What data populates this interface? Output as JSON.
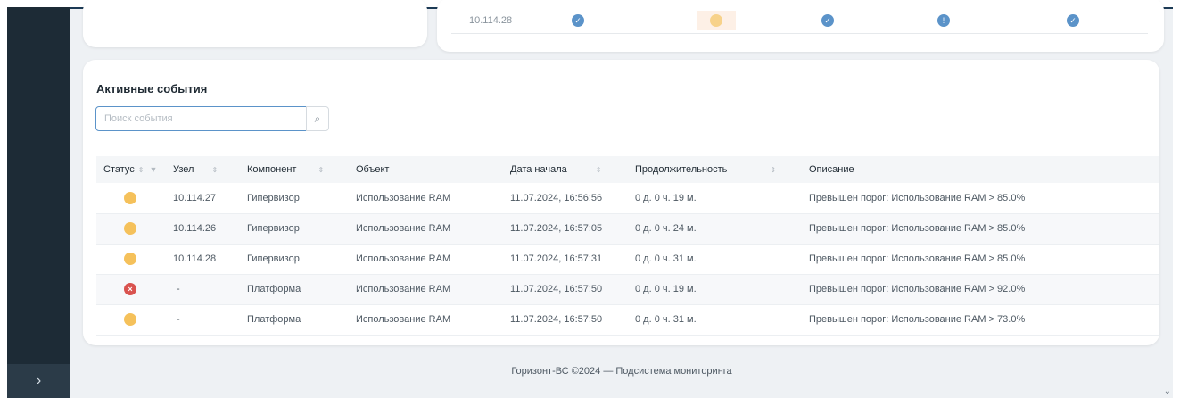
{
  "sidebar": {
    "toggle_icon": "chevron-right-icon",
    "toggle_glyph": "›"
  },
  "host_panel": {
    "ip": "10.114.28"
  },
  "events": {
    "title": "Активные события",
    "search": {
      "placeholder": "Поиск события",
      "icon": "search-icon",
      "glyph": "⌕"
    },
    "columns": [
      "Статус",
      "Узел",
      "Компонент",
      "Объект",
      "Дата начала",
      "Продолжительность",
      "Описание"
    ],
    "rows": [
      {
        "status": "warning",
        "node": "10.114.27",
        "component": "Гипервизор",
        "object": "Использование RAM",
        "start": "11.07.2024, 16:56:56",
        "duration": "0 д. 0 ч. 19 м.",
        "description": "Превышен порог: Использование RAM >  85.0%"
      },
      {
        "status": "warning",
        "node": "10.114.26",
        "component": "Гипервизор",
        "object": "Использование RAM",
        "start": "11.07.2024, 16:57:05",
        "duration": "0 д. 0 ч. 24 м.",
        "description": "Превышен порог: Использование RAM >  85.0%"
      },
      {
        "status": "warning",
        "node": "10.114.28",
        "component": "Гипервизор",
        "object": "Использование RAM",
        "start": "11.07.2024, 16:57:31",
        "duration": "0 д. 0 ч. 31 м.",
        "description": "Превышен порог: Использование RAM >  85.0%"
      },
      {
        "status": "error",
        "node": "-",
        "component": "Платформа",
        "object": "Использование RAM",
        "start": "11.07.2024, 16:57:50",
        "duration": "0 д. 0 ч. 19 м.",
        "description": "Превышен порог: Использование RAM >  92.0%"
      },
      {
        "status": "warning",
        "node": "-",
        "component": "Платформа",
        "object": "Использование RAM",
        "start": "11.07.2024, 16:57:50",
        "duration": "0 д. 0 ч. 31 м.",
        "description": "Превышен порог: Использование RAM >  73.0%"
      }
    ]
  },
  "footer": {
    "text": "Горизонт-ВС ©2024 — Подсистема мониторинга"
  },
  "colors": {
    "sidebar": "#1d2b36",
    "accent": "#5b93c9",
    "warning": "#f5c15b",
    "error": "#d9534f",
    "background": "#eef1f4"
  }
}
